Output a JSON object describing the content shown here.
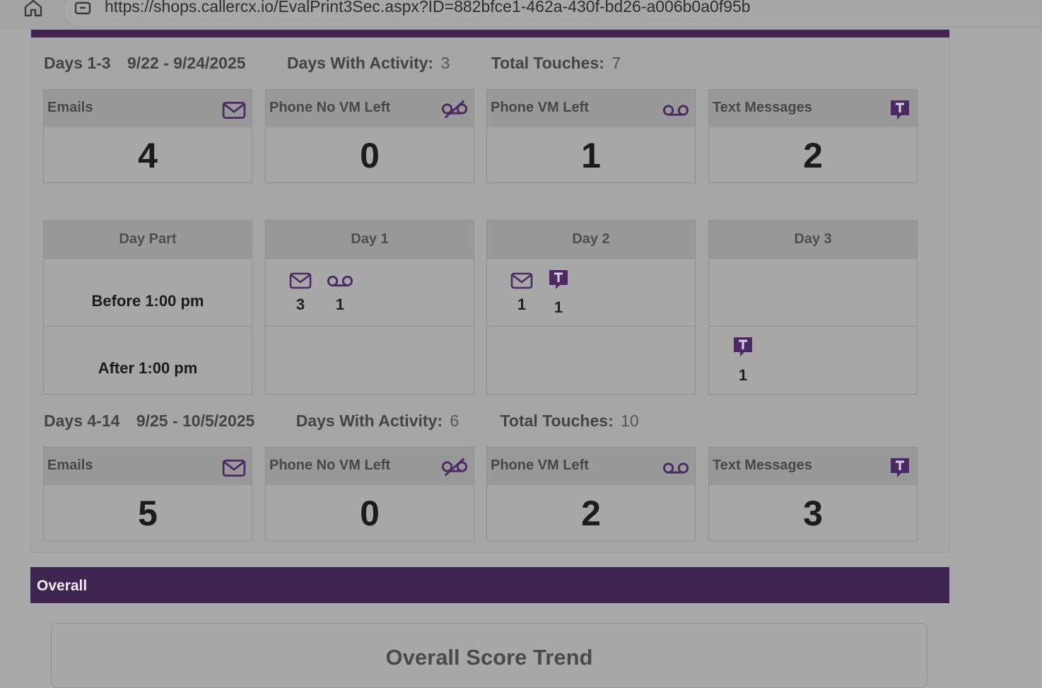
{
  "browser": {
    "url": "https://shops.callercx.io/EvalPrint3Sec.aspx?ID=882bfce1-462a-430f-bd26-a006b0a0f95b",
    "home_icon": "home-icon",
    "site_info_icon": "site-info-icon"
  },
  "colors": {
    "brand_purple": "#3f2652",
    "icon_purple": "#4b2a63"
  },
  "period1": {
    "label": "Days 1-3",
    "dates": "9/22 - 9/24/2025",
    "activity_label": "Days With Activity:",
    "activity_value": "3",
    "touches_label": "Total Touches:",
    "touches_value": "7",
    "cards": [
      {
        "label": "Emails",
        "value": "4",
        "icon": "envelope-icon"
      },
      {
        "label": "Phone No VM Left",
        "value": "0",
        "icon": "voicemail-slash-icon"
      },
      {
        "label": "Phone VM Left",
        "value": "1",
        "icon": "voicemail-icon"
      },
      {
        "label": "Text Messages",
        "value": "2",
        "icon": "text-message-icon"
      }
    ],
    "grid": {
      "headers": [
        "Day Part",
        "Day 1",
        "Day 2",
        "Day 3"
      ],
      "rows": [
        "Before 1:00 pm",
        "After 1:00 pm"
      ],
      "day1_before": {
        "email": "3",
        "voicemail": "1"
      },
      "day2_before": {
        "email": "1",
        "text": "1"
      },
      "day3_after": {
        "text": "1"
      }
    }
  },
  "period2": {
    "label": "Days 4-14",
    "dates": "9/25 - 10/5/2025",
    "activity_label": "Days With Activity:",
    "activity_value": "6",
    "touches_label": "Total Touches:",
    "touches_value": "10",
    "cards": [
      {
        "label": "Emails",
        "value": "5",
        "icon": "envelope-icon"
      },
      {
        "label": "Phone No VM Left",
        "value": "0",
        "icon": "voicemail-slash-icon"
      },
      {
        "label": "Phone VM Left",
        "value": "2",
        "icon": "voicemail-icon"
      },
      {
        "label": "Text Messages",
        "value": "3",
        "icon": "text-message-icon"
      }
    ]
  },
  "overall": {
    "title": "Overall",
    "trend_title": "Overall Score Trend"
  }
}
